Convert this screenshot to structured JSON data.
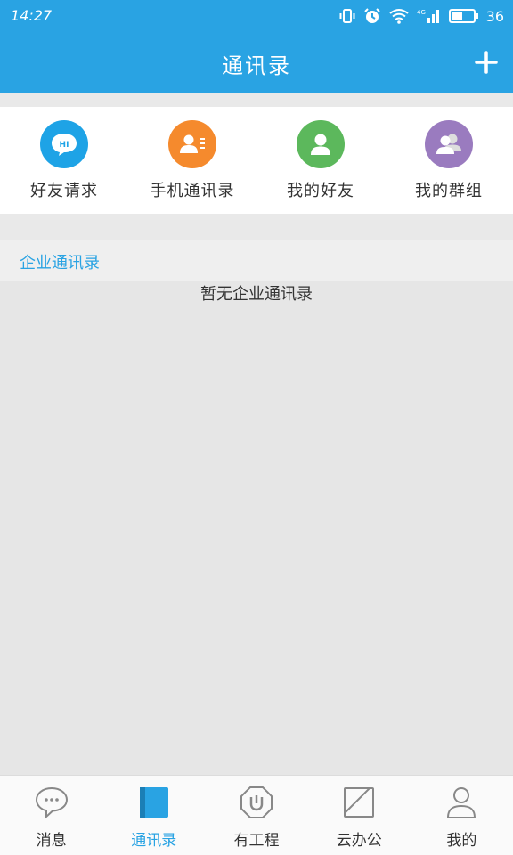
{
  "status_bar": {
    "time": "14:27",
    "battery_level": "36"
  },
  "header": {
    "title": "通讯录",
    "add_icon": "plus-icon"
  },
  "quick_actions": [
    {
      "label": "好友请求",
      "icon": "hi-chat-bubble-icon",
      "color": "#1ea3e6"
    },
    {
      "label": "手机通讯录",
      "icon": "phone-contacts-icon",
      "color": "#f58a2d"
    },
    {
      "label": "我的好友",
      "icon": "person-icon",
      "color": "#5cb85c"
    },
    {
      "label": "我的群组",
      "icon": "group-icon",
      "color": "#9a7bbf"
    }
  ],
  "section": {
    "title": "企业通讯录",
    "empty_message": "暂无企业通讯录"
  },
  "tabs": [
    {
      "label": "消息",
      "icon": "message-bubble-icon",
      "active": false
    },
    {
      "label": "通讯录",
      "icon": "contacts-book-icon",
      "active": true
    },
    {
      "label": "有工程",
      "icon": "project-icon",
      "active": false
    },
    {
      "label": "云办公",
      "icon": "cloud-office-icon",
      "active": false
    },
    {
      "label": "我的",
      "icon": "profile-icon",
      "active": false
    }
  ],
  "colors": {
    "primary": "#29a3e3",
    "background": "#e6e6e6"
  }
}
